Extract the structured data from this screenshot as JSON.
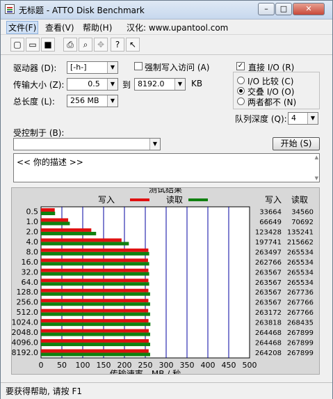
{
  "window": {
    "title": "无标题 - ATTO Disk Benchmark",
    "buttons": {
      "minimize": "–",
      "maximize": "□",
      "close": "✕"
    }
  },
  "menu": [
    "文件(F)",
    "查看(V)",
    "帮助(H)"
  ],
  "menu_note": "汉化: www.upantool.com",
  "toolbar": [
    "new-icon",
    "open-icon",
    "save-icon",
    "print-icon",
    "print-preview-icon",
    "move-icon",
    "help-icon",
    "context-help-icon"
  ],
  "form": {
    "drive_label": "驱动器 (D):",
    "drive_value": "[-h-]",
    "force_write_label": "强制写入访问 (A)",
    "force_write_checked": false,
    "direct_io_label": "直接 I/O (R)",
    "direct_io_checked": true,
    "transfer_label": "传输大小 (Z):",
    "transfer_from": "0.5",
    "to_label": "到",
    "transfer_to": "8192.0",
    "kb_label": "KB",
    "length_label": "总长度 (L):",
    "length_value": "256 MB",
    "io_compare": "I/O 比较 (C)",
    "overlapped_io": "交叠 I/O (O)",
    "neither": "两者都不 (N)",
    "queue_label": "队列深度 (Q):",
    "queue_value": "4",
    "controlled_label": "受控制于 (B):",
    "controlled_value": "",
    "start_button": "开始 (S)",
    "description": "<<  你的描述  >>"
  },
  "results": {
    "title": "测试结果",
    "write_legend": "写入",
    "read_legend": "读取",
    "write_col": "写入",
    "read_col": "读取",
    "xlabel": "传输速率 - MB / 秒",
    "write_color": "#e01010",
    "read_color": "#108010"
  },
  "chart_data": {
    "type": "bar",
    "orientation": "horizontal",
    "title": "测试结果",
    "xlabel": "传输速率 - MB / 秒",
    "xlim": [
      0,
      500
    ],
    "xticks": [
      0,
      50,
      100,
      150,
      200,
      250,
      300,
      350,
      400,
      450,
      500
    ],
    "categories": [
      "0.5",
      "1.0",
      "2.0",
      "4.0",
      "8.0",
      "16.0",
      "32.0",
      "64.0",
      "128.0",
      "256.0",
      "512.0",
      "1024.0",
      "2048.0",
      "4096.0",
      "8192.0"
    ],
    "series": [
      {
        "name": "写入",
        "color": "#e01010",
        "values": [
          33664,
          66649,
          123428,
          197741,
          263497,
          262766,
          263567,
          263567,
          263567,
          263567,
          263172,
          263818,
          264468,
          264468,
          264208
        ]
      },
      {
        "name": "读取",
        "color": "#108010",
        "values": [
          34560,
          70692,
          135241,
          215662,
          265534,
          265534,
          265534,
          265534,
          267736,
          267766,
          267766,
          268435,
          267899,
          267899,
          267899
        ]
      }
    ],
    "value_unit_kb": true
  },
  "status": "要获得帮助, 请按 F1"
}
